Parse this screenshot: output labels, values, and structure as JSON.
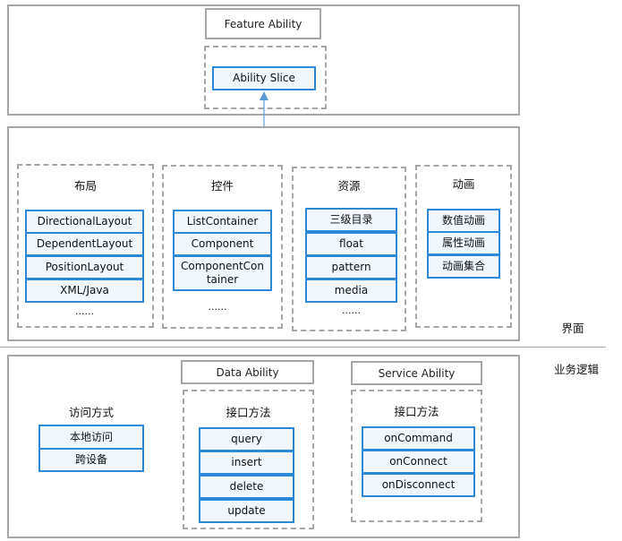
{
  "top": {
    "feature_ability": "Feature Ability",
    "ability_slice": "Ability Slice"
  },
  "ui": {
    "label": "界面",
    "groups": [
      {
        "title": "布局",
        "items": [
          "DirectionalLayout",
          "DependentLayout",
          "PositionLayout",
          "XML/Java"
        ],
        "more": "......"
      },
      {
        "title": "控件",
        "items": [
          "ListContainer",
          "Component",
          "ComponentContainer"
        ],
        "more": "......"
      },
      {
        "title": "资源",
        "items": [
          "三级目录",
          "float",
          "pattern",
          "media"
        ],
        "more": "......"
      },
      {
        "title": "动画",
        "items": [
          "数值动画",
          "属性动画",
          "动画集合"
        ]
      }
    ]
  },
  "logic": {
    "label": "业务逻辑",
    "access": {
      "title": "访问方式",
      "items": [
        "本地访问",
        "跨设备"
      ]
    },
    "data_ability": {
      "title": "Data Ability",
      "sub": "接口方法",
      "items": [
        "query",
        "insert",
        "delete",
        "update"
      ]
    },
    "service_ability": {
      "title": "Service Ability",
      "sub": "接口方法",
      "items": [
        "onCommand",
        "onConnect",
        "onDisconnect"
      ]
    }
  },
  "colors": {
    "item_border": "#2e88d8",
    "item_fill": "#f0f8fe",
    "frame": "#a6a6a6"
  }
}
